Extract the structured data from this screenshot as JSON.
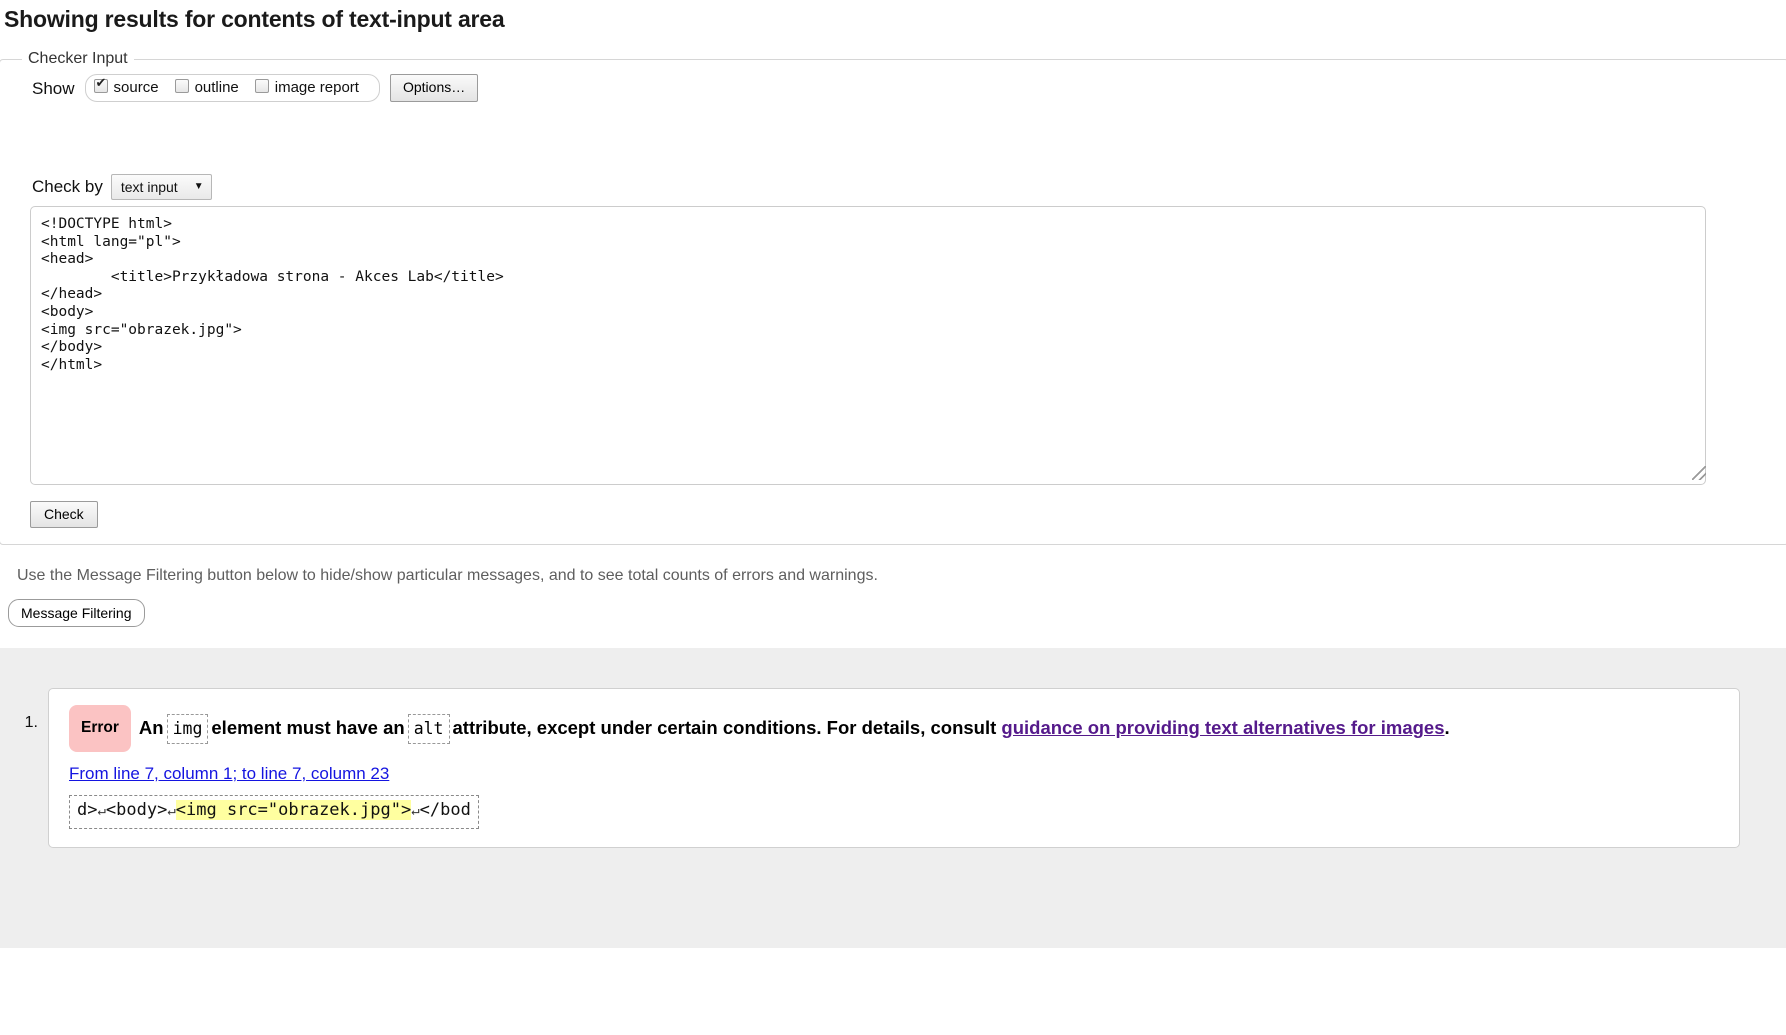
{
  "page": {
    "heading": "Showing results for contents of text-input area"
  },
  "checker": {
    "legend": "Checker Input",
    "show_label": "Show",
    "toggles": [
      {
        "label": "source",
        "checked": true
      },
      {
        "label": "outline",
        "checked": false
      },
      {
        "label": "image report",
        "checked": false
      }
    ],
    "options_button": "Options…",
    "checkby_label": "Check by",
    "checkby_value": "text input",
    "checkby_caret": "▼",
    "textarea_value": "<!DOCTYPE html>\n<html lang=\"pl\">\n<head>\n        <title>Przykładowa strona - Akces Lab</title>\n</head>\n<body>\n<img src=\"obrazek.jpg\">\n</body>\n</html>",
    "check_button": "Check"
  },
  "filtering": {
    "note": "Use the Message Filtering button below to hide/show particular messages, and to see total counts of errors and warnings.",
    "button": "Message Filtering"
  },
  "results": [
    {
      "number": "1.",
      "badge": "Error",
      "text_before_code1": "An",
      "code1": "img",
      "text_between": "element must have an",
      "code2": "alt",
      "text_after": "attribute, except under certain conditions. For details, consult",
      "link_text": "guidance on providing text alternatives for images",
      "text_end": ".",
      "location_text": "From line 7, column 1; to line 7, column 23",
      "extract_prefix": "d>",
      "extract_nl1": "↵",
      "extract_body_open": "<body>",
      "extract_nl2": "↵",
      "extract_highlight": "<img src=\"obrazek.jpg\">",
      "extract_nl3": "↵",
      "extract_suffix": "</bod"
    }
  ],
  "colors": {
    "error_badge_bg": "#fbc3c3",
    "highlight": "#ffffa0",
    "link_visited": "#551a8b",
    "link_blue": "#1414e0",
    "results_bg": "#eeeeee"
  }
}
